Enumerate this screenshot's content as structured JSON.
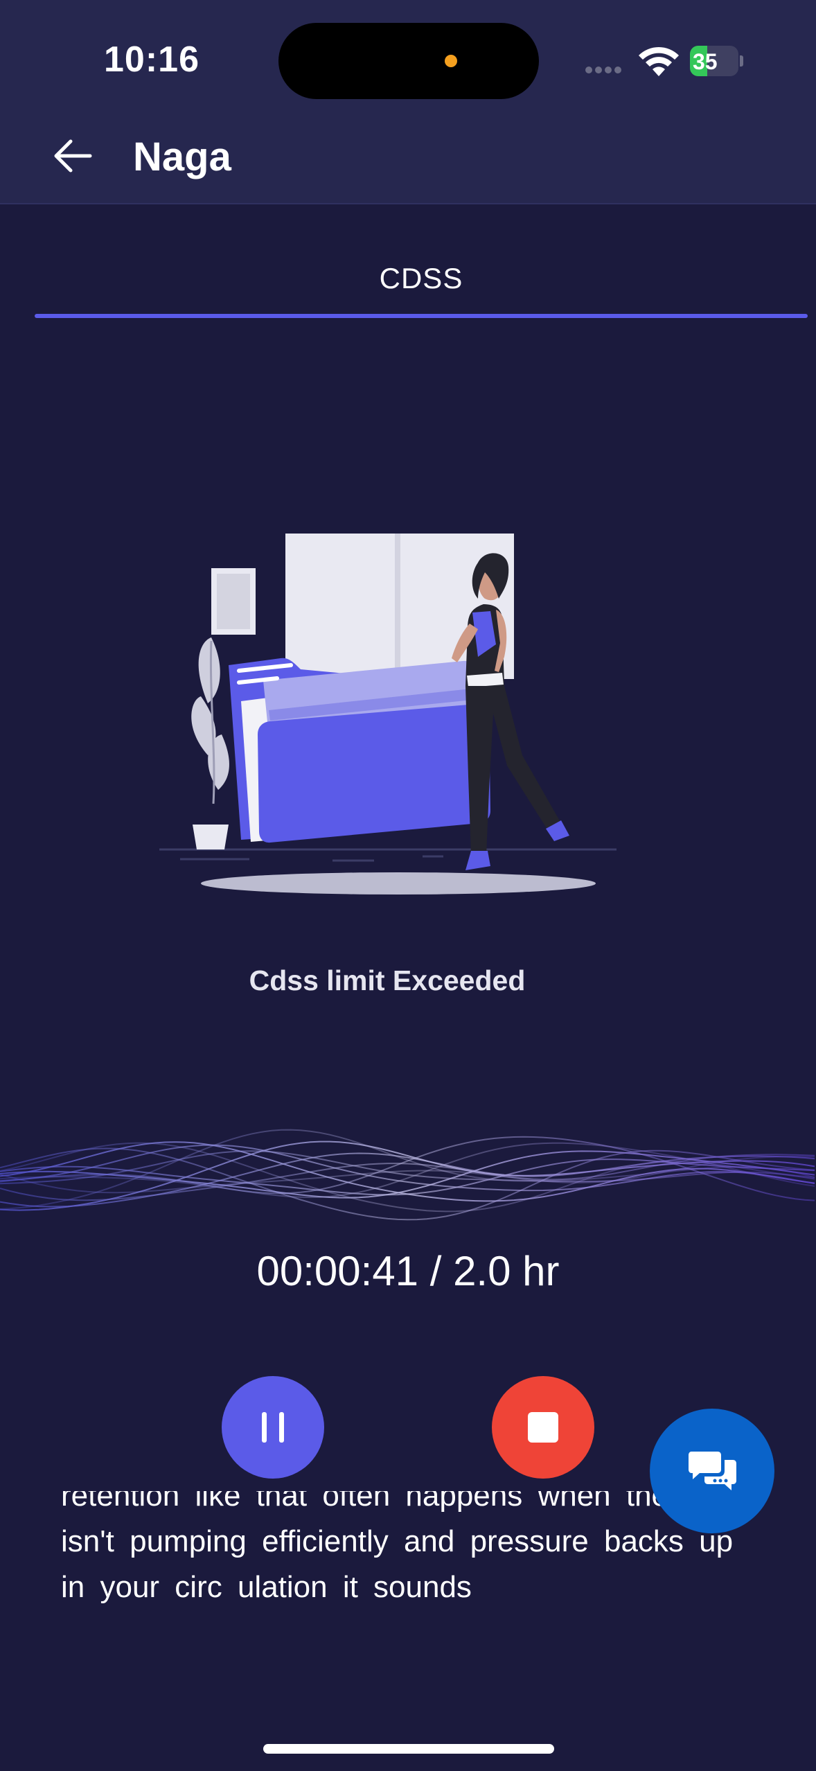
{
  "status_bar": {
    "time": "10:16",
    "battery": "35",
    "battery_level": 0.35
  },
  "header": {
    "title": "Naga",
    "back_icon": "arrow-left-icon"
  },
  "tabs": [
    {
      "label": "CDSS",
      "active": true
    }
  ],
  "main": {
    "illustration_icon": "folder-illustration",
    "message": "Cdss limit Exceeded"
  },
  "recorder": {
    "timer": "00:00:41 / 2.0 hr",
    "pause_icon": "pause-icon",
    "stop_icon": "stop-icon",
    "chat_icon": "chat-bubbles-icon"
  },
  "transcript": {
    "text": "retention like that often happens when the heart isn't pumping efficiently and pressure backs up in your circ ulation it sounds"
  },
  "colors": {
    "background": "#1b1a3d",
    "header": "#26274f",
    "accent": "#5b5bea",
    "stop": "#ef4437",
    "chat": "#0a63c9"
  }
}
